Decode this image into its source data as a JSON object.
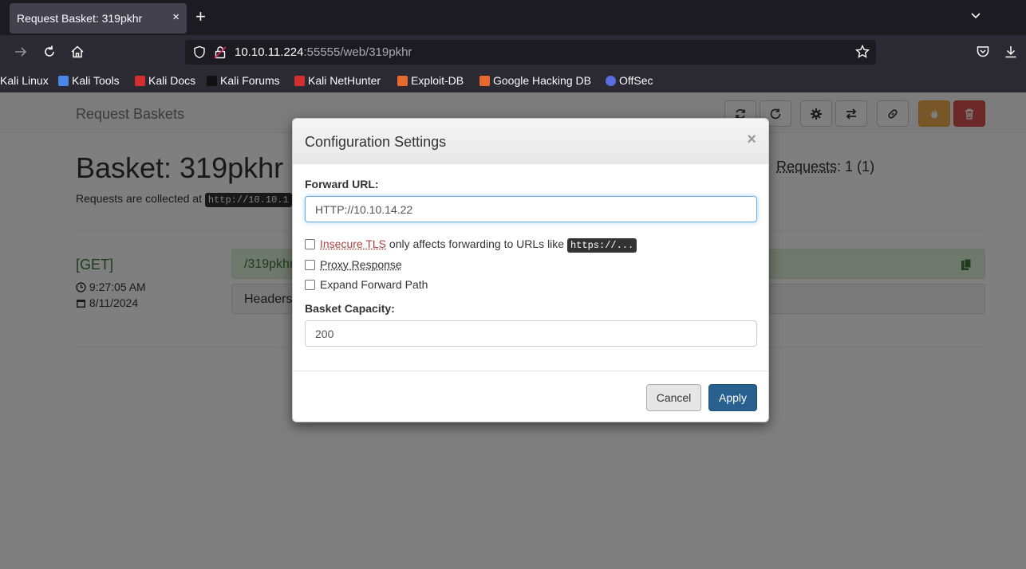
{
  "browser": {
    "tab_title": "Request Basket: 319pkhr",
    "tab_close": "×",
    "new_tab": "+",
    "url_host": "10.10.11.224",
    "url_rest": ":55555/web/319pkhr"
  },
  "bookmarks": [
    {
      "label": "Kali Linux",
      "color": "#367bf0"
    },
    {
      "label": "Kali Tools",
      "color": "#4a86e8"
    },
    {
      "label": "Kali Docs",
      "color": "#d32f2f"
    },
    {
      "label": "Kali Forums",
      "color": "#222222"
    },
    {
      "label": "Kali NetHunter",
      "color": "#d32f2f"
    },
    {
      "label": "Exploit-DB",
      "color": "#e8692f"
    },
    {
      "label": "Google Hacking DB",
      "color": "#e8692f"
    },
    {
      "label": "OffSec",
      "color": "#5b6ee1"
    }
  ],
  "app": {
    "brand": "Request Baskets",
    "basket_title": "Basket: 319pkhr",
    "collected_prefix": "Requests are collected at",
    "collected_url": "http://10.10.1",
    "requests_label": "Requests",
    "requests_value": ": 1 (1)"
  },
  "request": {
    "method": "[GET]",
    "time": "9:27:05 AM",
    "date": "8/11/2024",
    "path": "/319pkhr",
    "headers_label": "Headers"
  },
  "modal": {
    "title": "Configuration Settings",
    "close": "×",
    "forward_url_label": "Forward URL:",
    "forward_url_value": "HTTP://10.10.14.22",
    "insecure_tls": "Insecure TLS",
    "insecure_tls_desc": "only affects forwarding to URLs like",
    "insecure_tls_code": "https://...",
    "proxy_response": "Proxy Response",
    "expand_forward_path": "Expand Forward Path",
    "capacity_label": "Basket Capacity:",
    "capacity_value": "200",
    "cancel": "Cancel",
    "apply": "Apply"
  }
}
